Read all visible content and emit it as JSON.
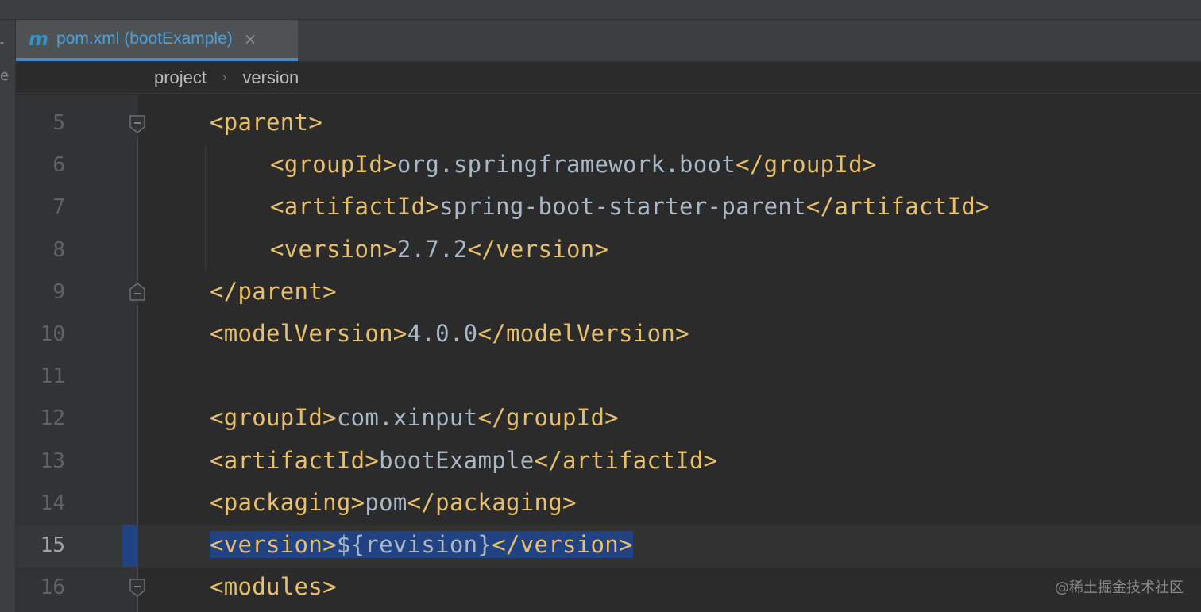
{
  "tab": {
    "icon": "maven-m-icon",
    "icon_glyph": "m",
    "title": "pom.xml (bootExample)",
    "close_glyph": "×"
  },
  "left_strip": {
    "dash": "-",
    "letter": "e"
  },
  "breadcrumb": {
    "items": [
      "project",
      "version"
    ],
    "separator": "›"
  },
  "editor": {
    "current_line": 15,
    "lines": [
      {
        "num": "5",
        "open": "<parent>",
        "value": "",
        "close": ""
      },
      {
        "num": "6",
        "open": "<groupId>",
        "value": "org.springframework.boot",
        "close": "</groupId>"
      },
      {
        "num": "7",
        "open": "<artifactId>",
        "value": "spring-boot-starter-parent",
        "close": "</artifactId>"
      },
      {
        "num": "8",
        "open": "<version>",
        "value": "2.7.2",
        "close": "</version>"
      },
      {
        "num": "9",
        "open": "</parent>",
        "value": "",
        "close": ""
      },
      {
        "num": "10",
        "open": "<modelVersion>",
        "value": "4.0.0",
        "close": "</modelVersion>"
      },
      {
        "num": "11",
        "open": "",
        "value": "",
        "close": ""
      },
      {
        "num": "12",
        "open": "<groupId>",
        "value": "com.xinput",
        "close": "</groupId>"
      },
      {
        "num": "13",
        "open": "<artifactId>",
        "value": "bootExample",
        "close": "</artifactId>"
      },
      {
        "num": "14",
        "open": "<packaging>",
        "value": "pom",
        "close": "</packaging>"
      },
      {
        "num": "15",
        "open": "<version>",
        "value": "${revision}",
        "close": "</version>"
      },
      {
        "num": "16",
        "open": "<modules>",
        "value": "",
        "close": ""
      }
    ]
  },
  "watermark": "@稀土掘金技术社区",
  "colors": {
    "background": "#2b2b2b",
    "tag": "#e8bf6a",
    "text": "#a9b7c6",
    "selection": "#214283",
    "tab_accent": "#4a88c7"
  }
}
